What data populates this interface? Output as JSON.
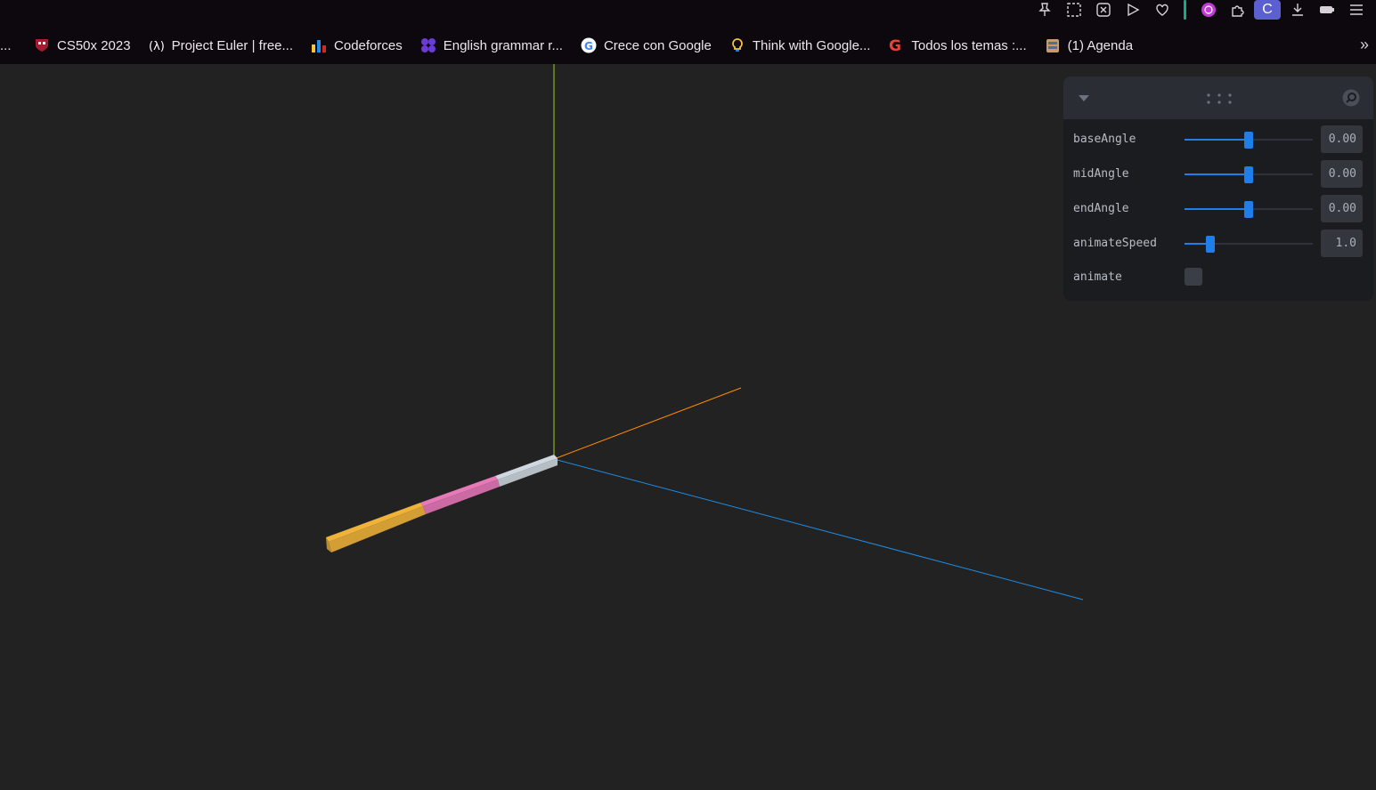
{
  "browser": {
    "top_icons": [
      "pin-icon",
      "screenshot-icon",
      "shield-x-icon",
      "play-icon",
      "heart-icon",
      "extension-magnifier-icon",
      "puzzle-icon",
      "profile-icon",
      "download-icon",
      "battery-icon",
      "menu-icon"
    ],
    "profile_initial": "C",
    "bookmarks_leading": "...",
    "bookmarks": [
      {
        "label": "CS50x 2023",
        "icon": "harvard-shield-icon",
        "color": "#a51c30"
      },
      {
        "label": "Project Euler | free...",
        "icon": "euler-icon",
        "color": "#ffffff"
      },
      {
        "label": "Codeforces",
        "icon": "codeforces-icon",
        "color": "#f6c43d"
      },
      {
        "label": "English grammar r...",
        "icon": "grammar-icon",
        "color": "#6a3bd6"
      },
      {
        "label": "Crece con Google",
        "icon": "google-icon",
        "color": "#ffffff"
      },
      {
        "label": "Think with Google...",
        "icon": "lightbulb-icon",
        "color": "#f6c43d"
      },
      {
        "label": "Todos los temas :...",
        "icon": "google-icon",
        "color": "#ffffff"
      },
      {
        "label": "(1) Agenda",
        "icon": "agenda-icon",
        "color": "#c99b6a"
      }
    ],
    "more_label": "»"
  },
  "scene": {
    "axis_colors": {
      "x": "#ff8a00",
      "y": "#9cd31a",
      "z": "#1f8de6"
    },
    "arm_segment_colors": [
      "#cfd8e0",
      "#e879b9",
      "#f0b33a"
    ]
  },
  "panel": {
    "controls": [
      {
        "label": "baseAngle",
        "value": "0.00",
        "fraction": 0.5
      },
      {
        "label": "midAngle",
        "value": "0.00",
        "fraction": 0.5
      },
      {
        "label": "endAngle",
        "value": "0.00",
        "fraction": 0.5
      },
      {
        "label": "animateSpeed",
        "value": "1.0",
        "fraction": 0.2
      }
    ],
    "animate_label": "animate",
    "animate_checked": false
  }
}
